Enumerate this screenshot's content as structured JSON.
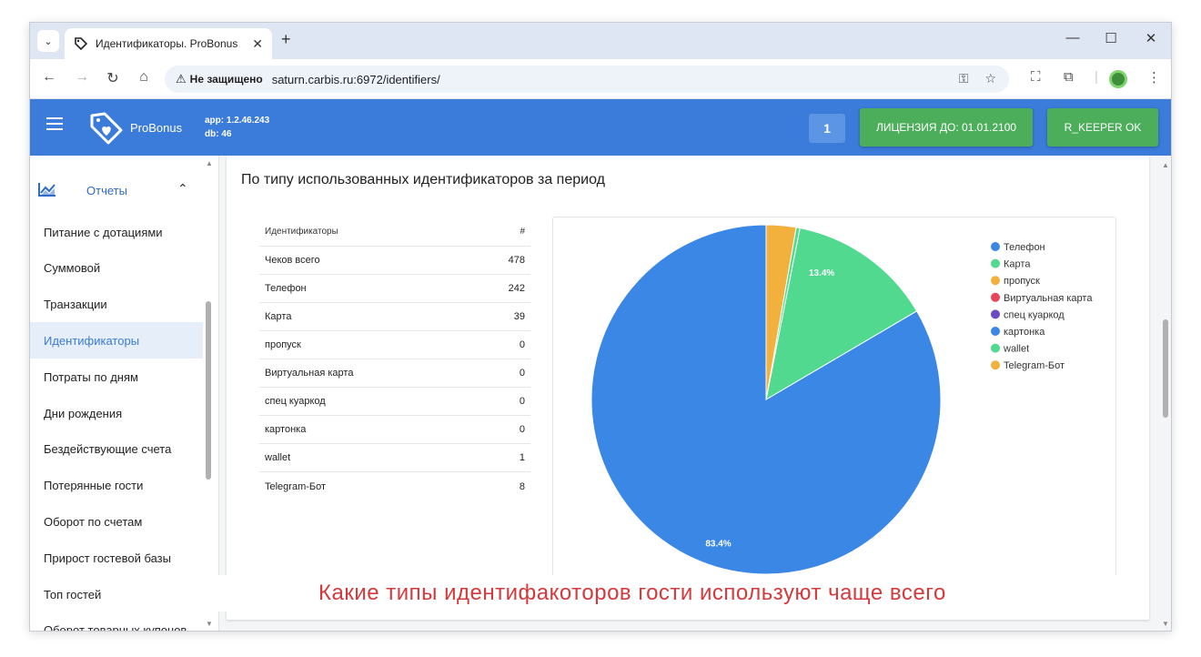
{
  "browser": {
    "tab_title": "Идентификаторы. ProBonus",
    "tab_close": "✕",
    "new_tab": "+",
    "win_min": "—",
    "win_max": "☐",
    "win_close": "✕",
    "insecure_label": "Не защищено",
    "url": "saturn.carbis.ru:6972/identifiers/"
  },
  "header": {
    "brand": "ProBonus",
    "app_version": "app: 1.2.46.243",
    "db_version": "db: 46",
    "counter": "1",
    "license_label": "ЛИЦЕНЗИЯ ДО: 01.01.2100",
    "keeper_label": "R_KEEPER OK",
    "colors": {
      "header": "#3b7bd9",
      "green": "#4cae5a"
    }
  },
  "sidebar": {
    "group_label": "Отчеты",
    "items": [
      {
        "label": "Питание с дотациями"
      },
      {
        "label": "Суммовой"
      },
      {
        "label": "Транзакции"
      },
      {
        "label": "Идентификаторы",
        "active": true
      },
      {
        "label": "Потраты по дням"
      },
      {
        "label": "Дни рождения"
      },
      {
        "label": "Бездействующие счета"
      },
      {
        "label": "Потерянные гости"
      },
      {
        "label": "Оборот по счетам"
      },
      {
        "label": "Прирост гостевой базы"
      },
      {
        "label": "Топ гостей"
      },
      {
        "label": "Оборот товарных купонов"
      }
    ]
  },
  "report": {
    "title": "По типу использованных идентификаторов за период",
    "table": {
      "col_name": "Идентификаторы",
      "col_count": "#",
      "rows": [
        {
          "name": "Чеков всего",
          "count": "478"
        },
        {
          "name": "Телефон",
          "count": "242"
        },
        {
          "name": "Карта",
          "count": "39"
        },
        {
          "name": "пропуск",
          "count": "0"
        },
        {
          "name": "Виртуальная карта",
          "count": "0"
        },
        {
          "name": "спец куаркод",
          "count": "0"
        },
        {
          "name": "картонка",
          "count": "0"
        },
        {
          "name": "wallet",
          "count": "1"
        },
        {
          "name": "Telegram-Бот",
          "count": "8"
        }
      ]
    }
  },
  "chart_data": {
    "type": "pie",
    "categories": [
      "Телефон",
      "Карта",
      "пропуск",
      "Виртуальная карта",
      "спец куаркод",
      "картонка",
      "wallet",
      "Telegram-Бот"
    ],
    "values": [
      242,
      39,
      0,
      0,
      0,
      0,
      1,
      8
    ],
    "slice_labels": [
      "83.4%",
      "13.4%",
      "",
      "",
      "",
      "",
      "",
      ""
    ],
    "colors": [
      "#3b87e6",
      "#50d98f",
      "#f2b03c",
      "#e8455b",
      "#6a4bc4",
      "#3b87e6",
      "#50d98f",
      "#f2b03c"
    ],
    "legend_position": "top-right"
  },
  "caption": "Какие типы идентифакоторов гости используют чаще всего"
}
